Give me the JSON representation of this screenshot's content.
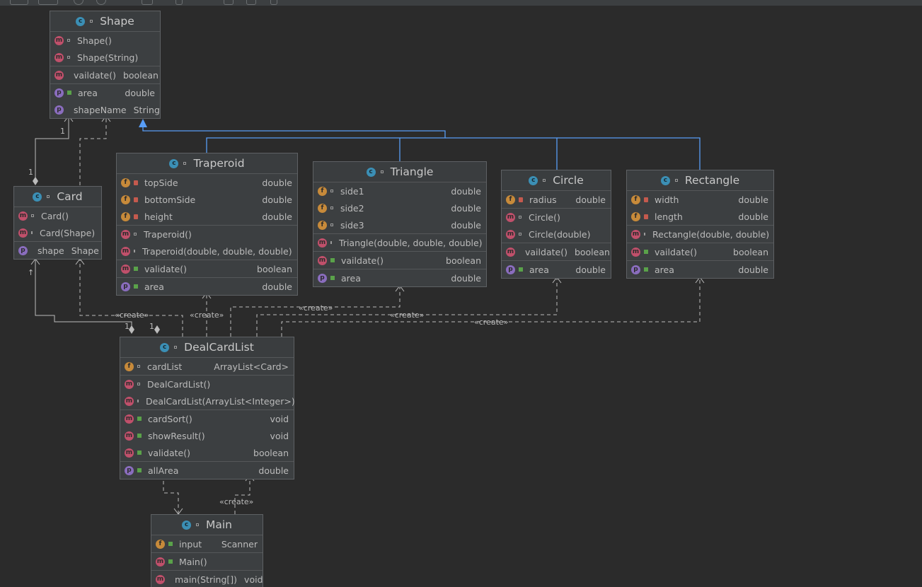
{
  "edge_labels": {
    "create": "«create»"
  },
  "multiplicity": {
    "one": "1",
    "arrow": "↑"
  },
  "classes": {
    "shape": {
      "name": "Shape",
      "rows": [
        [
          {
            "kind": "m",
            "vis": "pkg",
            "name": "Shape()",
            "type": ""
          },
          {
            "kind": "m",
            "vis": "pkg",
            "name": "Shape(String)",
            "type": ""
          }
        ],
        [
          {
            "kind": "m",
            "vis": "public",
            "name": "vaildate()",
            "type": "boolean"
          }
        ],
        [
          {
            "kind": "p",
            "vis": "public",
            "name": "area",
            "type": "double"
          },
          {
            "kind": "p",
            "vis": "public",
            "name": "shapeName",
            "type": "String"
          }
        ]
      ]
    },
    "card": {
      "name": "Card",
      "rows": [
        [
          {
            "kind": "m",
            "vis": "pkg",
            "name": "Card()",
            "type": ""
          },
          {
            "kind": "m",
            "vis": "pkg",
            "name": "Card(Shape)",
            "type": ""
          }
        ],
        [
          {
            "kind": "p",
            "vis": "public",
            "name": "shape",
            "type": "Shape"
          }
        ]
      ]
    },
    "traperoid": {
      "name": "Traperoid",
      "rows": [
        [
          {
            "kind": "f",
            "vis": "private",
            "name": "topSide",
            "type": "double"
          },
          {
            "kind": "f",
            "vis": "private",
            "name": "bottomSide",
            "type": "double"
          },
          {
            "kind": "f",
            "vis": "private",
            "name": "height",
            "type": "double"
          }
        ],
        [
          {
            "kind": "m",
            "vis": "pkg",
            "name": "Traperoid()",
            "type": ""
          },
          {
            "kind": "m",
            "vis": "pkg",
            "name": "Traperoid(double, double, double)",
            "type": ""
          }
        ],
        [
          {
            "kind": "m",
            "vis": "public",
            "name": "validate()",
            "type": "boolean"
          }
        ],
        [
          {
            "kind": "p",
            "vis": "public",
            "name": "area",
            "type": "double"
          }
        ]
      ]
    },
    "triangle": {
      "name": "Triangle",
      "rows": [
        [
          {
            "kind": "f",
            "vis": "pkg",
            "name": "side1",
            "type": "double"
          },
          {
            "kind": "f",
            "vis": "pkg",
            "name": "side2",
            "type": "double"
          },
          {
            "kind": "f",
            "vis": "pkg",
            "name": "side3",
            "type": "double"
          }
        ],
        [
          {
            "kind": "m",
            "vis": "pkg",
            "name": "Triangle(double, double, double)",
            "type": ""
          }
        ],
        [
          {
            "kind": "m",
            "vis": "public",
            "name": "vaildate()",
            "type": "boolean"
          }
        ],
        [
          {
            "kind": "p",
            "vis": "public",
            "name": "area",
            "type": "double"
          }
        ]
      ]
    },
    "circle": {
      "name": "Circle",
      "rows": [
        [
          {
            "kind": "f",
            "vis": "private",
            "name": "radius",
            "type": "double"
          }
        ],
        [
          {
            "kind": "m",
            "vis": "pkg",
            "name": "Circle()",
            "type": ""
          },
          {
            "kind": "m",
            "vis": "pkg",
            "name": "Circle(double)",
            "type": ""
          }
        ],
        [
          {
            "kind": "m",
            "vis": "public",
            "name": "vaildate()",
            "type": "boolean"
          }
        ],
        [
          {
            "kind": "p",
            "vis": "public",
            "name": "area",
            "type": "double"
          }
        ]
      ]
    },
    "rectangle": {
      "name": "Rectangle",
      "rows": [
        [
          {
            "kind": "f",
            "vis": "private",
            "name": "width",
            "type": "double"
          },
          {
            "kind": "f",
            "vis": "private",
            "name": "length",
            "type": "double"
          }
        ],
        [
          {
            "kind": "m",
            "vis": "pkg",
            "name": "Rectangle(double, double)",
            "type": ""
          }
        ],
        [
          {
            "kind": "m",
            "vis": "public",
            "name": "vaildate()",
            "type": "boolean"
          }
        ],
        [
          {
            "kind": "p",
            "vis": "public",
            "name": "area",
            "type": "double"
          }
        ]
      ]
    },
    "dealcardlist": {
      "name": "DealCardList",
      "rows": [
        [
          {
            "kind": "f",
            "vis": "pkg",
            "name": "cardList",
            "type": "ArrayList<Card>"
          }
        ],
        [
          {
            "kind": "m",
            "vis": "pkg",
            "name": "DealCardList()",
            "type": ""
          },
          {
            "kind": "m",
            "vis": "pkg",
            "name": "DealCardList(ArrayList<Integer>)",
            "type": ""
          }
        ],
        [
          {
            "kind": "m",
            "vis": "public",
            "name": "cardSort()",
            "type": "void"
          },
          {
            "kind": "m",
            "vis": "public",
            "name": "showResult()",
            "type": "void"
          },
          {
            "kind": "m",
            "vis": "public",
            "name": "validate()",
            "type": "boolean"
          }
        ],
        [
          {
            "kind": "p",
            "vis": "public",
            "name": "allArea",
            "type": "double"
          }
        ]
      ]
    },
    "main": {
      "name": "Main",
      "rows": [
        [
          {
            "kind": "f",
            "vis": "public",
            "name": "input",
            "type": "Scanner"
          }
        ],
        [
          {
            "kind": "m",
            "vis": "public",
            "name": "Main()",
            "type": ""
          }
        ],
        [
          {
            "kind": "m",
            "vis": "public",
            "name": "main(String[])",
            "type": "void"
          }
        ]
      ]
    }
  }
}
